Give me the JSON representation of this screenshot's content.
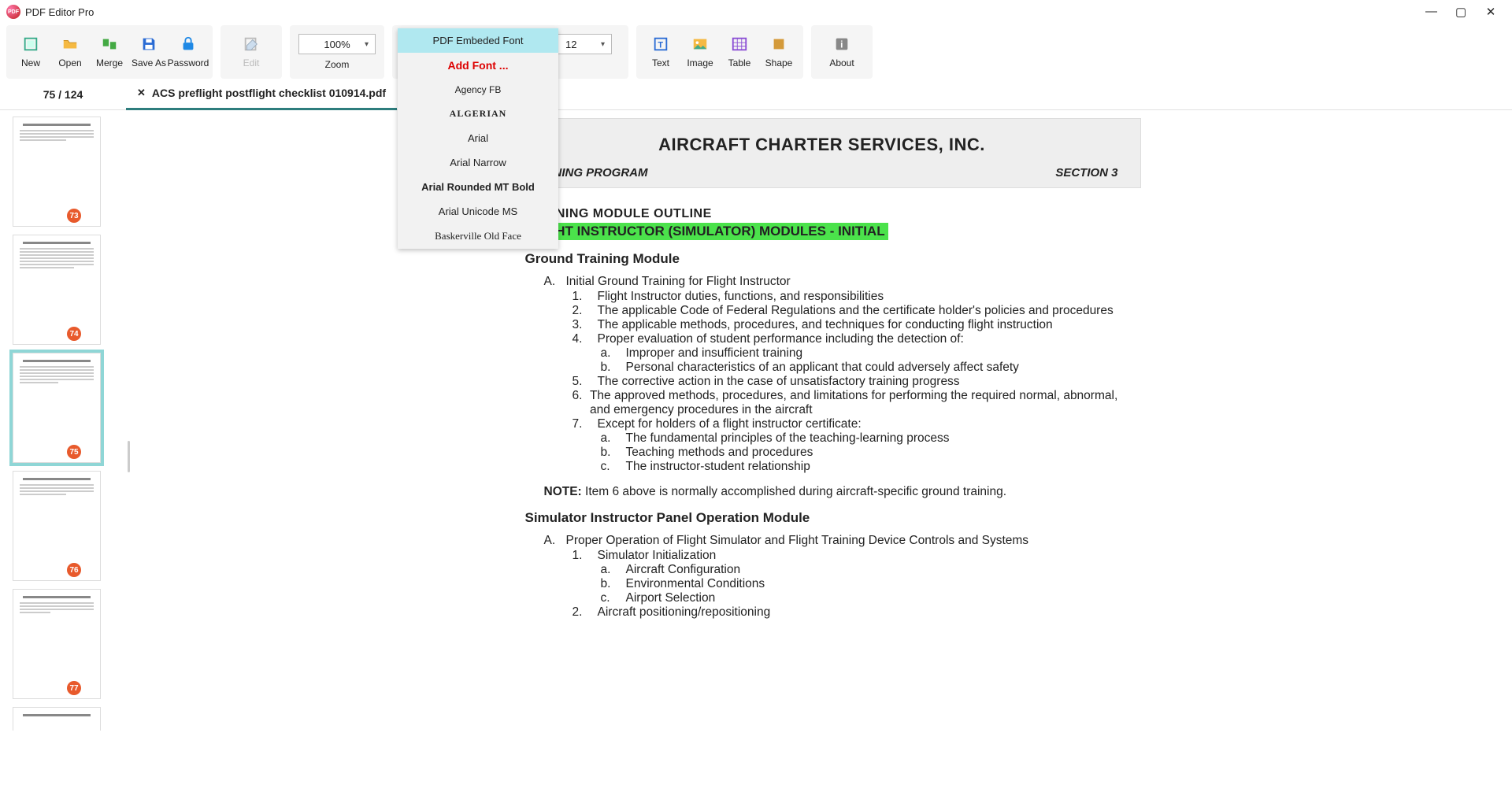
{
  "window": {
    "title": "PDF Editor Pro"
  },
  "ribbon": {
    "file": {
      "new": "New",
      "open": "Open",
      "merge": "Merge",
      "saveas": "Save As",
      "password": "Password"
    },
    "edit": "Edit",
    "zoom": {
      "value": "100%",
      "label": "Zoom"
    },
    "font": {
      "size": "12"
    },
    "insert": {
      "text": "Text",
      "image": "Image",
      "table": "Table",
      "shape": "Shape"
    },
    "about": "About"
  },
  "font_dropdown": {
    "selected": "PDF Embeded Font",
    "add": "Add Font ...",
    "items": [
      "Agency FB",
      "ALGERIAN",
      "Arial",
      "Arial Narrow",
      "Arial Rounded MT Bold",
      "Arial Unicode MS",
      "Baskerville Old Face"
    ]
  },
  "tabs": {
    "page_indicator": "75 / 124",
    "filename": "ACS preflight postflight checklist 010914.pdf"
  },
  "thumbs": [
    73,
    74,
    75,
    76,
    77
  ],
  "thumbs_selected_index": 2,
  "document": {
    "company": "AIRCRAFT CHARTER SERVICES, INC.",
    "program": "TRAINING PROGRAM",
    "section": "SECTION 3",
    "outline_title": "TRAINING MODULE OUTLINE",
    "highlight": "FLIGHT INSTRUCTOR (SIMULATOR) MODULES - INITIAL",
    "ground_title": "Ground Training Module",
    "ground_A": "Initial Ground Training for Flight Instructor",
    "ground_list": {
      "n1": "Flight Instructor duties, functions, and responsibilities",
      "n2": "The applicable Code of Federal Regulations and the certificate holder's policies and procedures",
      "n3": "The applicable methods, procedures, and techniques for conducting flight instruction",
      "n4": "Proper evaluation of student performance including the detection of:",
      "n4a": "Improper and insufficient training",
      "n4b": "Personal characteristics of an applicant that could adversely affect safety",
      "n5": "The corrective action in the case of unsatisfactory training progress",
      "n6": "The approved methods, procedures, and limitations for performing the required normal, abnormal, and emergency procedures in the aircraft",
      "n7": "Except for holders of a flight instructor certificate:",
      "n7a": "The fundamental principles of the teaching-learning process",
      "n7b": "Teaching methods and procedures",
      "n7c": "The instructor-student relationship"
    },
    "note_label": "NOTE:",
    "note_text": " Item 6 above is normally accomplished during aircraft-specific ground training.",
    "sim_title": "Simulator Instructor Panel Operation Module",
    "sim_A": "Proper Operation of Flight Simulator and Flight Training Device Controls and Systems",
    "sim_list": {
      "n1": "Simulator Initialization",
      "n1a": "Aircraft Configuration",
      "n1b": "Environmental Conditions",
      "n1c": "Airport Selection",
      "n2": "Aircraft positioning/repositioning"
    }
  }
}
